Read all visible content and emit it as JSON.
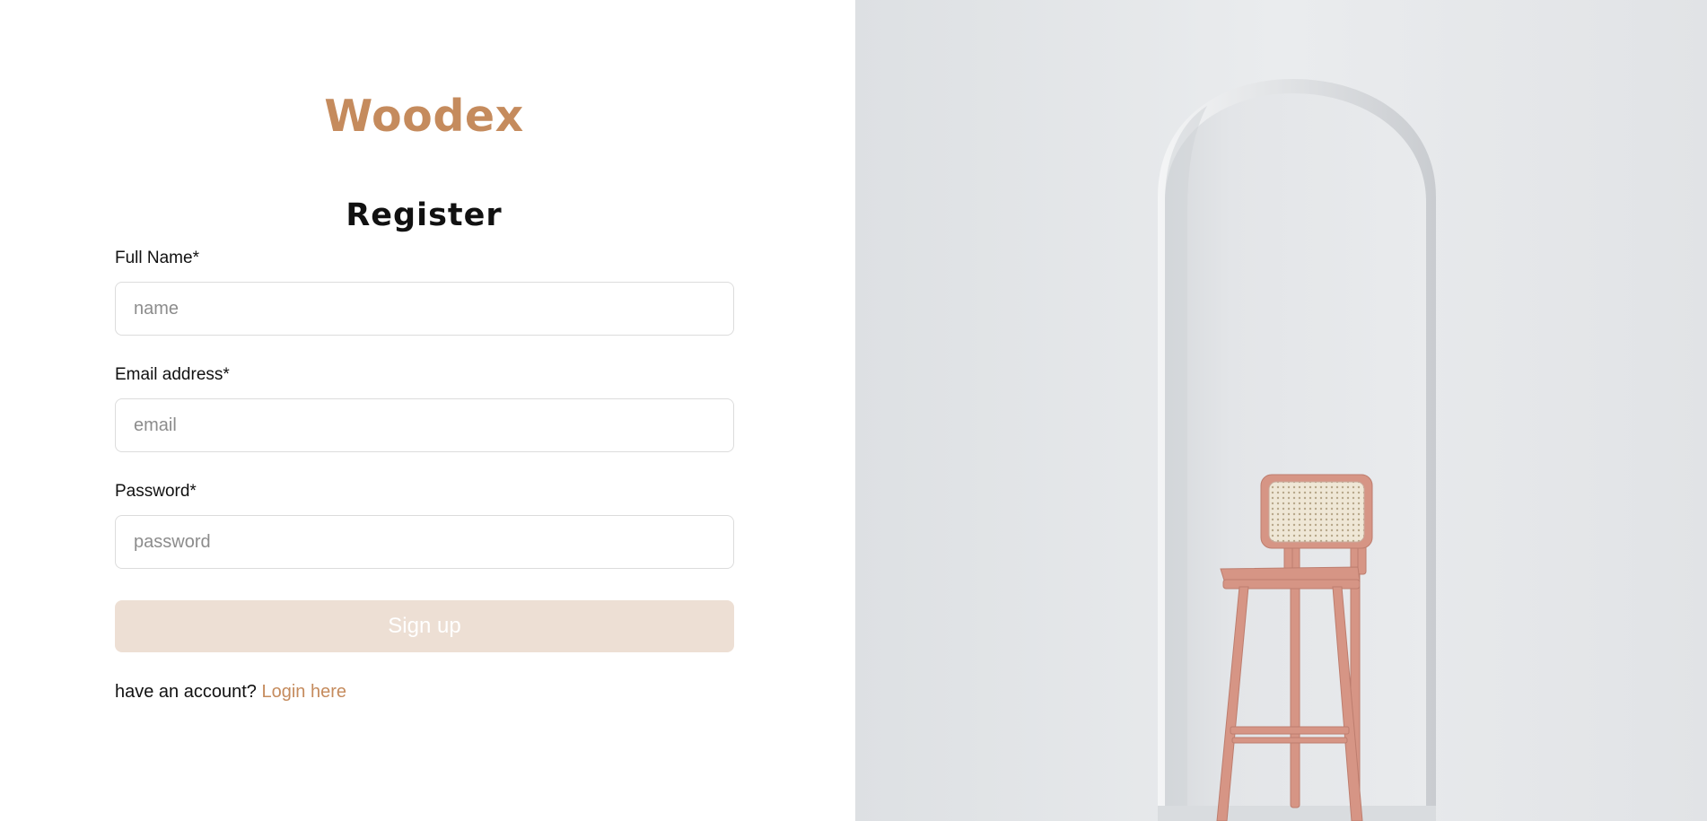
{
  "brand": {
    "name": "Woodex"
  },
  "form": {
    "title": "Register",
    "fields": [
      {
        "label": "Full Name*",
        "placeholder": "name"
      },
      {
        "label": "Email address*",
        "placeholder": "email"
      },
      {
        "label": "Password*",
        "placeholder": "password"
      }
    ],
    "submit_label": "Sign up",
    "footer_text": "have an account?",
    "footer_link": "Login here"
  },
  "hero_image": {
    "subject": "pink wooden bar stool with rattan backrest inside a white arched niche"
  },
  "colors": {
    "accent": "#c58b5d",
    "button_disabled": "#eddfd4",
    "chair": "#d69585"
  }
}
